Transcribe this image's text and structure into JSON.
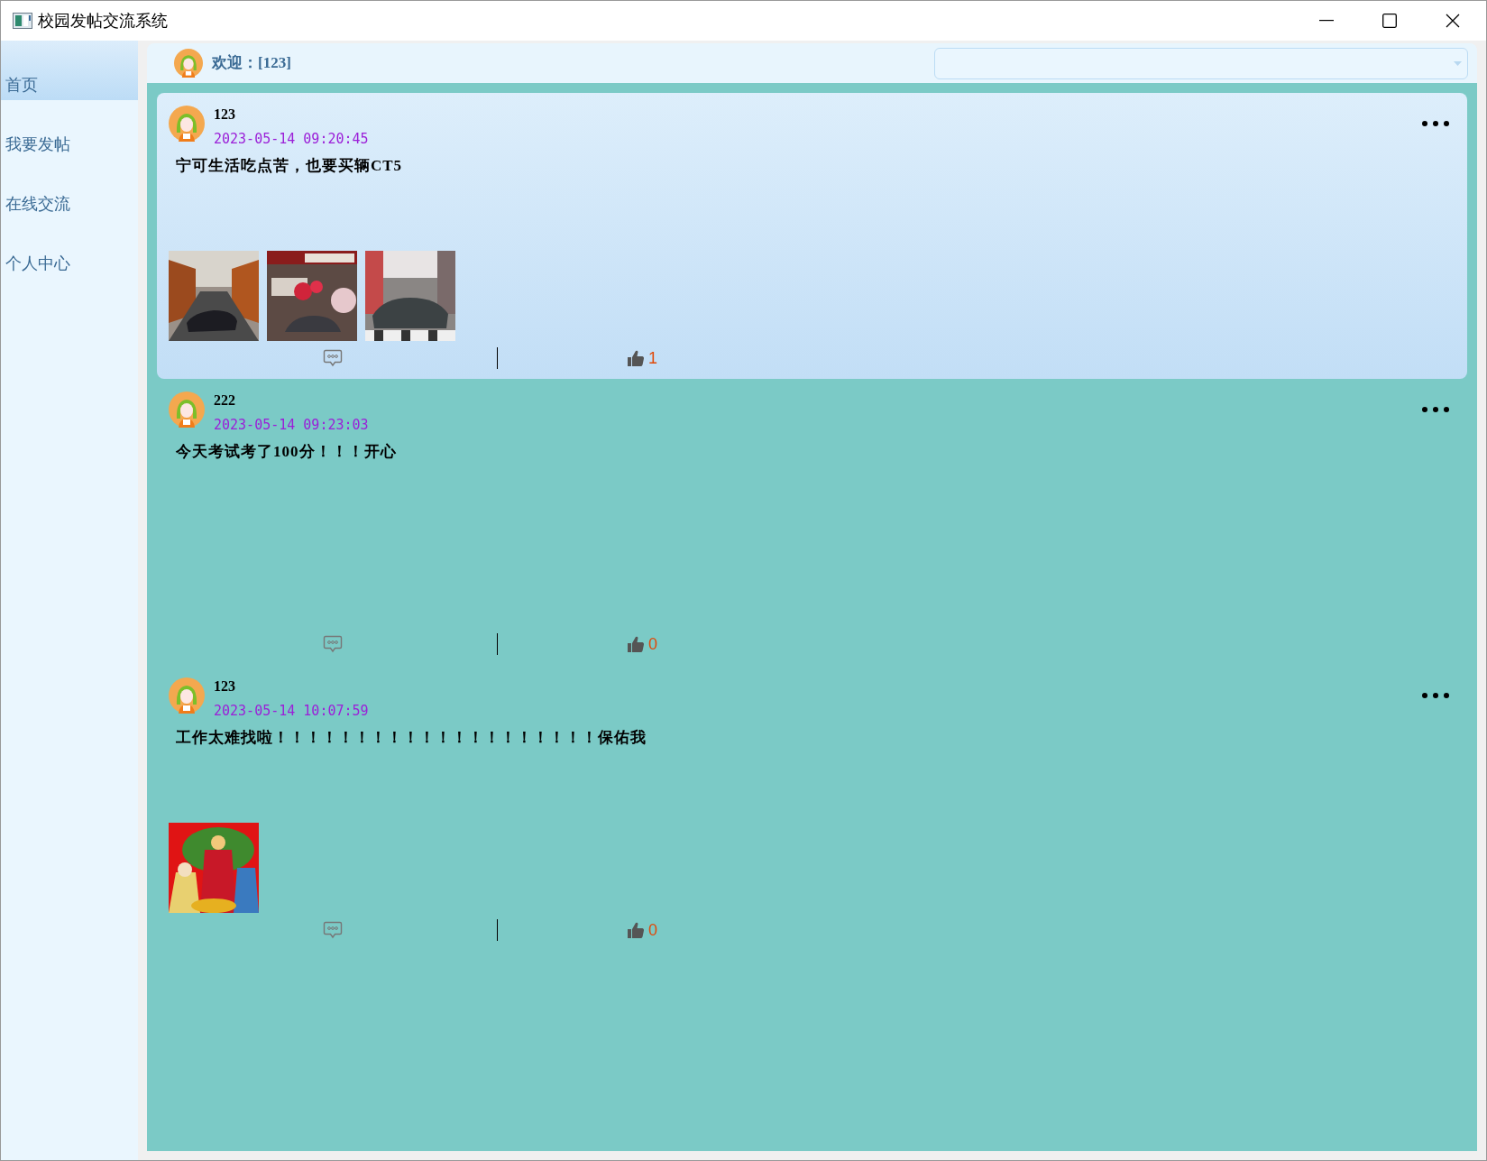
{
  "window": {
    "title": "校园发帖交流系统"
  },
  "sidebar": {
    "items": [
      {
        "label": "首页",
        "selected": true
      },
      {
        "label": "我要发帖",
        "selected": false
      },
      {
        "label": "在线交流",
        "selected": false
      },
      {
        "label": "个人中心",
        "selected": false
      }
    ]
  },
  "header": {
    "welcome": "欢迎：[123]"
  },
  "posts": [
    {
      "author": "123",
      "time": "2023-05-14 09:20:45",
      "text": "宁可生活吃点苦，也要买辆CT5",
      "likes": "1",
      "selected": true
    },
    {
      "author": "222",
      "time": "2023-05-14 09:23:03",
      "text": "今天考试考了100分！！！开心",
      "likes": "0",
      "selected": false
    },
    {
      "author": "123",
      "time": "2023-05-14 10:07:59",
      "text": "工作太难找啦！！！！！！！！！！！！！！！！！！！！保佑我",
      "likes": "0",
      "selected": false
    }
  ]
}
